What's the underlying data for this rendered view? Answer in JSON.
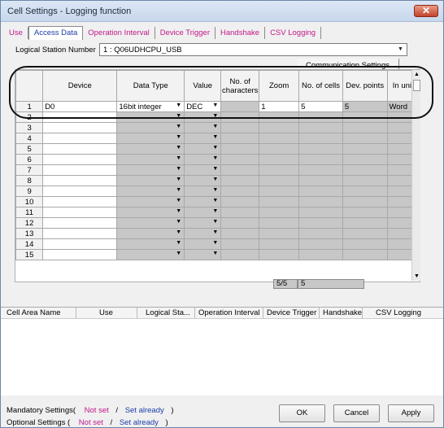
{
  "window": {
    "title": "Cell Settings - Logging function",
    "close_icon": "✕"
  },
  "tabs": [
    {
      "label": "Use"
    },
    {
      "label": "Access Data"
    },
    {
      "label": "Operation Interval"
    },
    {
      "label": "Device Trigger"
    },
    {
      "label": "Handshake"
    },
    {
      "label": "CSV Logging"
    }
  ],
  "active_tab_index": 1,
  "logical_station": {
    "label": "Logical  Station Number",
    "value": "1 : Q06UDHCPU_USB"
  },
  "comm_settings_label": "Communication Settings",
  "grid": {
    "columns": [
      "",
      "Device",
      "Data Type",
      "Value",
      "No. of characters",
      "Zoom",
      "No. of cells",
      "Dev. points",
      "In unit"
    ],
    "rows": [
      {
        "num": "1",
        "device": "D0",
        "data_type": "16bit integer",
        "value": "DEC",
        "chars": "",
        "zoom": "1",
        "cells": "5",
        "dev_points": "5",
        "in_unit": "Word"
      },
      {
        "num": "2",
        "device": "",
        "data_type": "",
        "value": "",
        "chars": "",
        "zoom": "",
        "cells": "",
        "dev_points": "",
        "in_unit": ""
      },
      {
        "num": "3",
        "device": "",
        "data_type": "",
        "value": "",
        "chars": "",
        "zoom": "",
        "cells": "",
        "dev_points": "",
        "in_unit": ""
      },
      {
        "num": "4",
        "device": "",
        "data_type": "",
        "value": "",
        "chars": "",
        "zoom": "",
        "cells": "",
        "dev_points": "",
        "in_unit": ""
      },
      {
        "num": "5",
        "device": "",
        "data_type": "",
        "value": "",
        "chars": "",
        "zoom": "",
        "cells": "",
        "dev_points": "",
        "in_unit": ""
      },
      {
        "num": "6",
        "device": "",
        "data_type": "",
        "value": "",
        "chars": "",
        "zoom": "",
        "cells": "",
        "dev_points": "",
        "in_unit": ""
      },
      {
        "num": "7",
        "device": "",
        "data_type": "",
        "value": "",
        "chars": "",
        "zoom": "",
        "cells": "",
        "dev_points": "",
        "in_unit": ""
      },
      {
        "num": "8",
        "device": "",
        "data_type": "",
        "value": "",
        "chars": "",
        "zoom": "",
        "cells": "",
        "dev_points": "",
        "in_unit": ""
      },
      {
        "num": "9",
        "device": "",
        "data_type": "",
        "value": "",
        "chars": "",
        "zoom": "",
        "cells": "",
        "dev_points": "",
        "in_unit": ""
      },
      {
        "num": "10",
        "device": "",
        "data_type": "",
        "value": "",
        "chars": "",
        "zoom": "",
        "cells": "",
        "dev_points": "",
        "in_unit": ""
      },
      {
        "num": "11",
        "device": "",
        "data_type": "",
        "value": "",
        "chars": "",
        "zoom": "",
        "cells": "",
        "dev_points": "",
        "in_unit": ""
      },
      {
        "num": "12",
        "device": "",
        "data_type": "",
        "value": "",
        "chars": "",
        "zoom": "",
        "cells": "",
        "dev_points": "",
        "in_unit": ""
      },
      {
        "num": "13",
        "device": "",
        "data_type": "",
        "value": "",
        "chars": "",
        "zoom": "",
        "cells": "",
        "dev_points": "",
        "in_unit": ""
      },
      {
        "num": "14",
        "device": "",
        "data_type": "",
        "value": "",
        "chars": "",
        "zoom": "",
        "cells": "",
        "dev_points": "",
        "in_unit": ""
      },
      {
        "num": "15",
        "device": "",
        "data_type": "",
        "value": "",
        "chars": "",
        "zoom": "",
        "cells": "",
        "dev_points": "",
        "in_unit": ""
      }
    ],
    "summary_cells": "5/5",
    "summary_points": "5"
  },
  "bottom_table": {
    "columns": [
      "Cell Area Name",
      "Use",
      "Logical Sta...",
      "Operation Interval",
      "Device Trigger",
      "Handshake",
      "CSV Logging"
    ]
  },
  "mandatory_settings": {
    "label": "Mandatory Settings(",
    "not_set": "Not set",
    "sep": "/",
    "set_already": "Set already",
    "close": ")"
  },
  "optional_settings": {
    "label": "Optional Settings  (",
    "not_set": "Not set",
    "sep": "/",
    "set_already": "Set already",
    "close": ")"
  },
  "buttons": {
    "ok": "OK",
    "cancel": "Cancel",
    "apply": "Apply"
  },
  "icons": {
    "dropdown": "chevron-down-icon",
    "scroll_up": "scroll-up-icon",
    "scroll_down": "scroll-down-icon",
    "close": "close-icon"
  },
  "colors": {
    "tab_link": "#c0198a",
    "tab_active": "#1a3ea8",
    "not_set": "#c0198a",
    "set_already": "#1a3ea8",
    "disabled_cell": "#c7c7c7"
  }
}
